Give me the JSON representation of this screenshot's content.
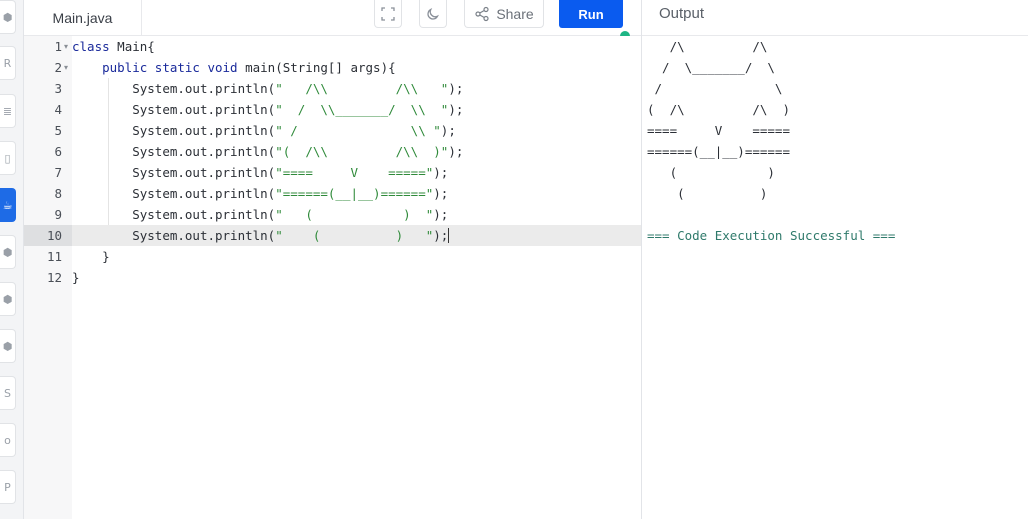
{
  "rail": {
    "items": [
      {
        "icon": "cpp-icon",
        "glyph": "⬢"
      },
      {
        "icon": "r-icon",
        "glyph": "R"
      },
      {
        "icon": "db-icon",
        "glyph": "≣"
      },
      {
        "icon": "html-icon",
        "glyph": "▯"
      },
      {
        "icon": "java-icon",
        "glyph": "☕"
      },
      {
        "icon": "cs-icon",
        "glyph": "⬢"
      },
      {
        "icon": "c-icon",
        "glyph": "⬢"
      },
      {
        "icon": "c2-icon",
        "glyph": "⬢"
      },
      {
        "icon": "swift-icon",
        "glyph": "S"
      },
      {
        "icon": "go-icon",
        "glyph": "o"
      },
      {
        "icon": "php-icon",
        "glyph": "P"
      }
    ]
  },
  "editor": {
    "file_name": "Main.java",
    "share_label": "Share",
    "run_label": "Run",
    "active_line": 10,
    "lines": [
      {
        "n": "1",
        "fold": "▾"
      },
      {
        "n": "2",
        "fold": "▾"
      },
      {
        "n": "3",
        "fold": ""
      },
      {
        "n": "4",
        "fold": ""
      },
      {
        "n": "5",
        "fold": ""
      },
      {
        "n": "6",
        "fold": ""
      },
      {
        "n": "7",
        "fold": ""
      },
      {
        "n": "8",
        "fold": ""
      },
      {
        "n": "9",
        "fold": ""
      },
      {
        "n": "10",
        "fold": ""
      },
      {
        "n": "11",
        "fold": ""
      },
      {
        "n": "12",
        "fold": ""
      }
    ],
    "code": {
      "l1_kw": "class",
      "l1_rest": " Main{",
      "l2_kw": "public static void",
      "l2_rest": " main(String[] args){",
      "print_prefix": "System.out.println(",
      "s3": "\"   /\\\\         /\\\\   \"",
      "s4": "\"  /  \\\\_______/  \\\\  \"",
      "s5": "\" /               \\\\ \"",
      "s6": "\"(  /\\\\         /\\\\  )\"",
      "s7": "\"====     V    =====\"",
      "s8": "\"======(__|__)======\"",
      "s9": "\"   (            )  \"",
      "s10": "\"    (          )   \"",
      "close_paren": ");",
      "l11": "    }",
      "l12": "}"
    }
  },
  "output": {
    "title": "Output",
    "lines": [
      "   /\\         /\\",
      "  /  \\_______/  \\",
      " /               \\",
      "(  /\\         /\\  )",
      "====     V    =====",
      "======(__|__)======",
      "   (            )",
      "    (          )",
      ""
    ],
    "success": "=== Code Execution Successful ==="
  }
}
